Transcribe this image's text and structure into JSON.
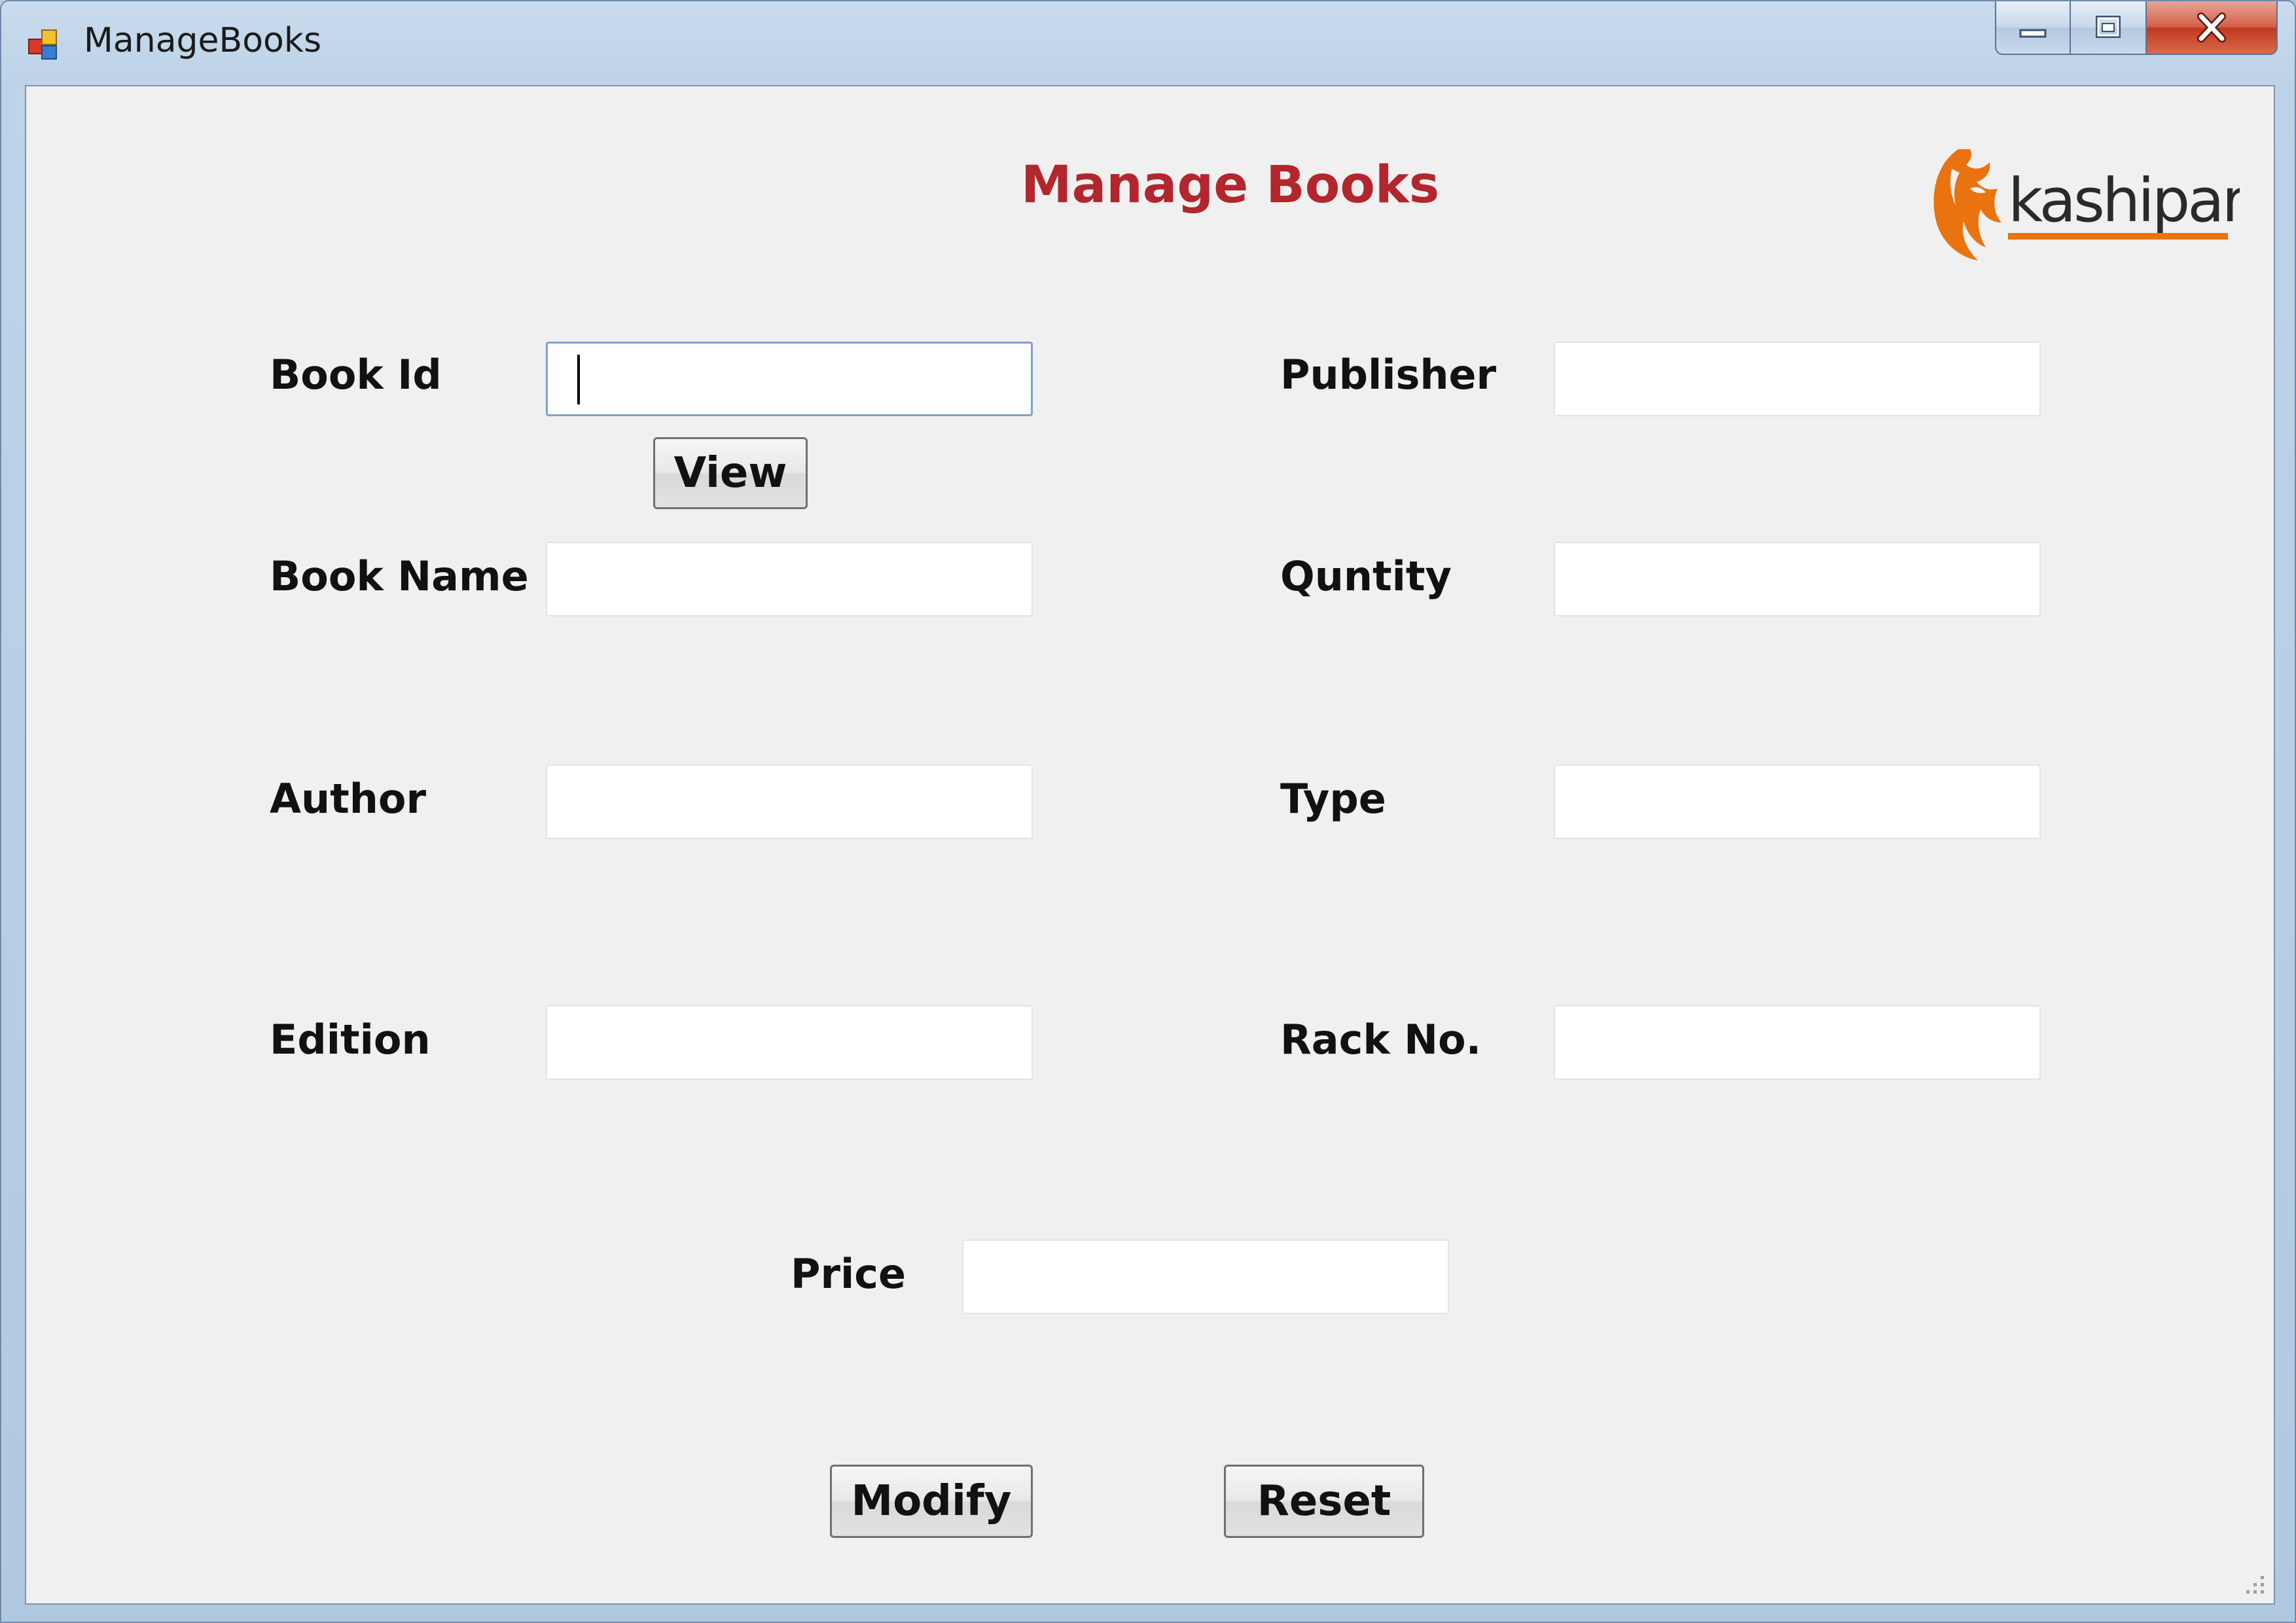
{
  "window": {
    "title": "ManageBooks",
    "icon": "app-windows-icon"
  },
  "title_controls": {
    "minimize": "minimize-icon",
    "maximize": "maximize-icon",
    "close": "close-icon"
  },
  "form": {
    "heading": "Manage Books",
    "logo_text": "kashipara",
    "fields": {
      "book_id": {
        "label": "Book Id",
        "value": ""
      },
      "publisher": {
        "label": "Publisher",
        "value": ""
      },
      "book_name": {
        "label": "Book Name",
        "value": ""
      },
      "quantity": {
        "label": "Quntity",
        "value": ""
      },
      "author": {
        "label": "Author",
        "value": ""
      },
      "type": {
        "label": "Type",
        "value": ""
      },
      "edition": {
        "label": "Edition",
        "value": ""
      },
      "rack_no": {
        "label": "Rack No.",
        "value": ""
      },
      "price": {
        "label": "Price",
        "value": ""
      }
    },
    "buttons": {
      "view": "View",
      "modify": "Modify",
      "reset": "Reset"
    }
  },
  "colors": {
    "heading": "#b3262d",
    "logo_orange": "#e8730f",
    "form_background": "#f0f0f0"
  }
}
